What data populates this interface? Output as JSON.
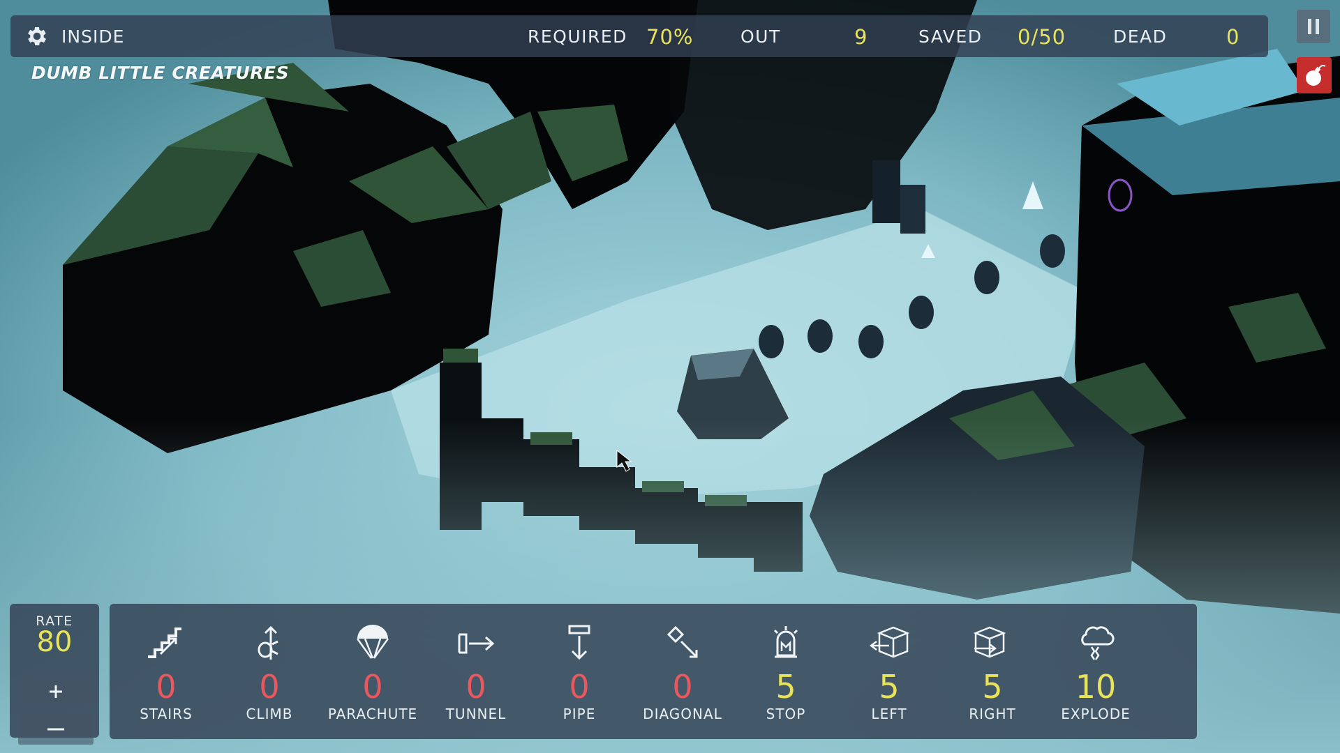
{
  "hud": {
    "level_name": "INSIDE",
    "required_label": "REQUIRED",
    "required_value": "70%",
    "out_label": "OUT",
    "out_value": "9",
    "saved_label": "SAVED",
    "saved_value": "0/50",
    "dead_label": "DEAD",
    "dead_value": "0"
  },
  "game_title": "DUMB LITTLE CREATURES",
  "rate": {
    "label": "RATE",
    "value": "80",
    "plus": "+",
    "minus": "−"
  },
  "skills": [
    {
      "name": "stairs",
      "count": "0",
      "label": "STAIRS",
      "icon": "stairs-icon"
    },
    {
      "name": "climb",
      "count": "0",
      "label": "CLIMB",
      "icon": "climb-icon"
    },
    {
      "name": "parachute",
      "count": "0",
      "label": "PARACHUTE",
      "icon": "parachute-icon"
    },
    {
      "name": "tunnel",
      "count": "0",
      "label": "TUNNEL",
      "icon": "tunnel-icon"
    },
    {
      "name": "pipe",
      "count": "0",
      "label": "PIPE",
      "icon": "pipe-icon"
    },
    {
      "name": "diagonal",
      "count": "0",
      "label": "DIAGONAL",
      "icon": "diagonal-icon"
    },
    {
      "name": "stop",
      "count": "5",
      "label": "STOP",
      "icon": "stop-icon"
    },
    {
      "name": "left",
      "count": "5",
      "label": "LEFT",
      "icon": "left-icon"
    },
    {
      "name": "right",
      "count": "5",
      "label": "RIGHT",
      "icon": "right-icon"
    },
    {
      "name": "explode",
      "count": "10",
      "label": "EXPLODE",
      "icon": "explode-icon"
    }
  ],
  "colors": {
    "accent_yellow": "#e9e35a",
    "zero_red": "#e8585e",
    "panel": "#324052",
    "bomb_red": "#c62d2d"
  }
}
